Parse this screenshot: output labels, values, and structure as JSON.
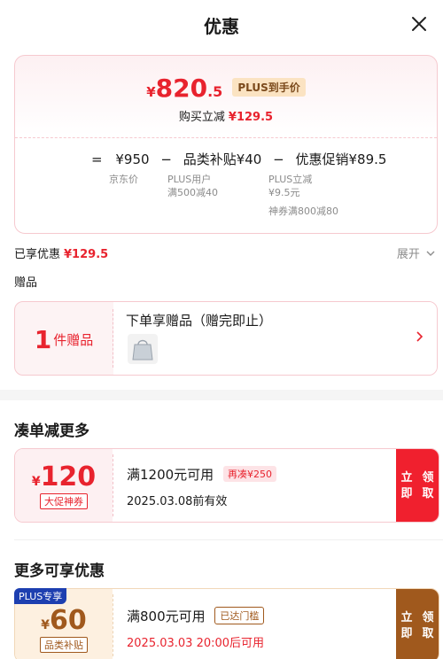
{
  "header": {
    "title": "优惠",
    "close_icon": "close-icon"
  },
  "price_card": {
    "currency": "¥",
    "final_int": "820",
    "final_dec": ".5",
    "plus_badge": "PLUS到手价",
    "discount_label": "购买立减",
    "discount_value": "¥129.5",
    "formula": {
      "eq": "=",
      "base_price": "¥950",
      "base_label": "京东价",
      "minus1": "−",
      "item2_label": "品类补贴",
      "item2_value": "¥40",
      "item2_sub1": "PLUS用户",
      "item2_sub2": "满500减40",
      "minus2": "−",
      "item3_label": "优惠促销",
      "item3_value": "¥89.5",
      "item3_sub1": "PLUS立减",
      "item3_sub2": "¥9.5元",
      "item3_sub3": "神券满800减80"
    }
  },
  "enjoyed": {
    "label": "已享优惠",
    "value": "¥129.5",
    "expand": "展开"
  },
  "gift": {
    "section_label": "赠品",
    "count": "1",
    "unit": "件赠品",
    "title": "下单享赠品（赠完即止）"
  },
  "section1": {
    "title": "凑单减更多",
    "coupon": {
      "currency": "¥",
      "amount": "120",
      "tag": "大促神券",
      "condition": "满1200元可用",
      "badge": "再凑¥250",
      "date": "2025.03.08前有效",
      "button": "立即领取"
    }
  },
  "section2": {
    "title": "更多可享优惠",
    "plus_tag": "PLUS专享",
    "coupon": {
      "currency": "¥",
      "amount": "60",
      "tag": "品类补贴",
      "condition": "满800元可用",
      "badge": "已达门槛",
      "date": "2025.03.03 20:00后可用",
      "button": "立即领取"
    }
  },
  "colors": {
    "red": "#e8232e",
    "pink_border": "#f6c9cf",
    "brown": "#a0591d",
    "plus_blue": "#1d3fb0"
  }
}
